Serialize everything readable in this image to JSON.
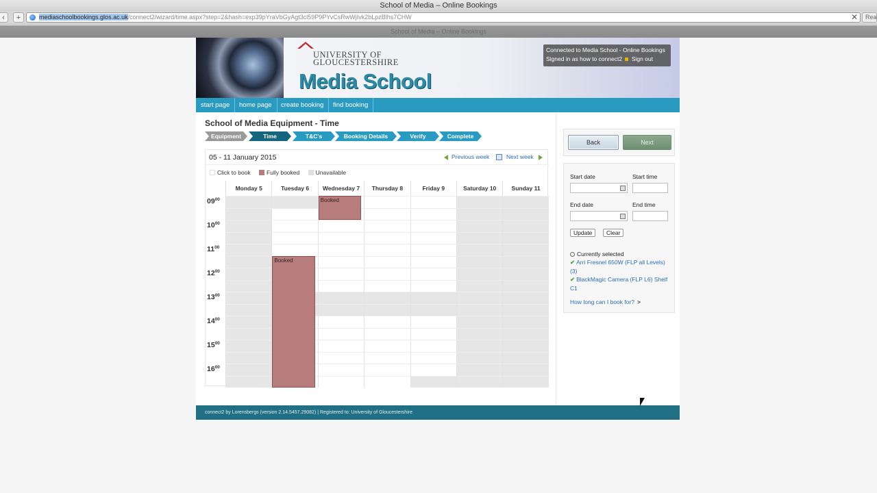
{
  "browser": {
    "window_title": "School of Media – Online Bookings",
    "nav_back": "‹",
    "nav_add": "+",
    "url_host": "mediaschoolbookings.glos.ac.uk",
    "url_path": "/connect2/wizard/time.aspx?step=2&hash=exp39pYraVbGyAgt3cl59P9PYvCsRwWjIvk2bLpzBlhs7CHW",
    "close": "✕",
    "reader": "Rea",
    "tab_title": "School of Media – Online Bookings"
  },
  "banner": {
    "university": "UNIVERSITY OF",
    "university2": "GLOUCESTERSHIRE",
    "school": "Media School",
    "connected": "Connected to Media School - Online Bookings",
    "signed_in": "Signed in as how to connect2",
    "sign_out": "Sign out"
  },
  "topnav": [
    "start page",
    "home page",
    "create booking",
    "find booking"
  ],
  "heading": "School of Media Equipment - Time",
  "steps": [
    {
      "label": "Equipment",
      "state": "done"
    },
    {
      "label": "Time",
      "state": "active"
    },
    {
      "label": "T&C's",
      "state": "todo"
    },
    {
      "label": "Booking Details",
      "state": "todo"
    },
    {
      "label": "Verify",
      "state": "todo"
    },
    {
      "label": "Complete",
      "state": "todo"
    }
  ],
  "calendar": {
    "week_label": "05 - 11 January 2015",
    "prev_week": "Previous week",
    "next_week": "Next week",
    "legend": {
      "click": "Click to book",
      "booked": "Fully booked",
      "unavailable": "Unavailable"
    },
    "days": [
      "Monday 5",
      "Tuesday 6",
      "Wednesday 7",
      "Thursday 8",
      "Friday 9",
      "Saturday 10",
      "Sunday 11"
    ],
    "hours": [
      "09",
      "10",
      "11",
      "12",
      "13",
      "14",
      "15",
      "16"
    ],
    "minutes": "00",
    "booked_label": "Booked",
    "colors": {
      "free": "#ffffff",
      "unavailable": "#e6e6e6",
      "booked": "#b77d7d"
    }
  },
  "panel": {
    "back": "Back",
    "next": "Next",
    "start_date": "Start date",
    "start_time": "Start time",
    "end_date": "End date",
    "end_time": "End time",
    "update": "Update",
    "clear": "Clear",
    "currently_selected": "Currently selected",
    "selected_items": [
      "Arri Fresnel 650W (FLP all Levels) (3)",
      "BlackMagic Camera (FLP L6) Shelf C1"
    ],
    "how_long": "How long can I book for?"
  },
  "footer": "connect2 by Lorensbergs (version 2.14.5457.29082) | Registered to: University of Gloucestershire"
}
